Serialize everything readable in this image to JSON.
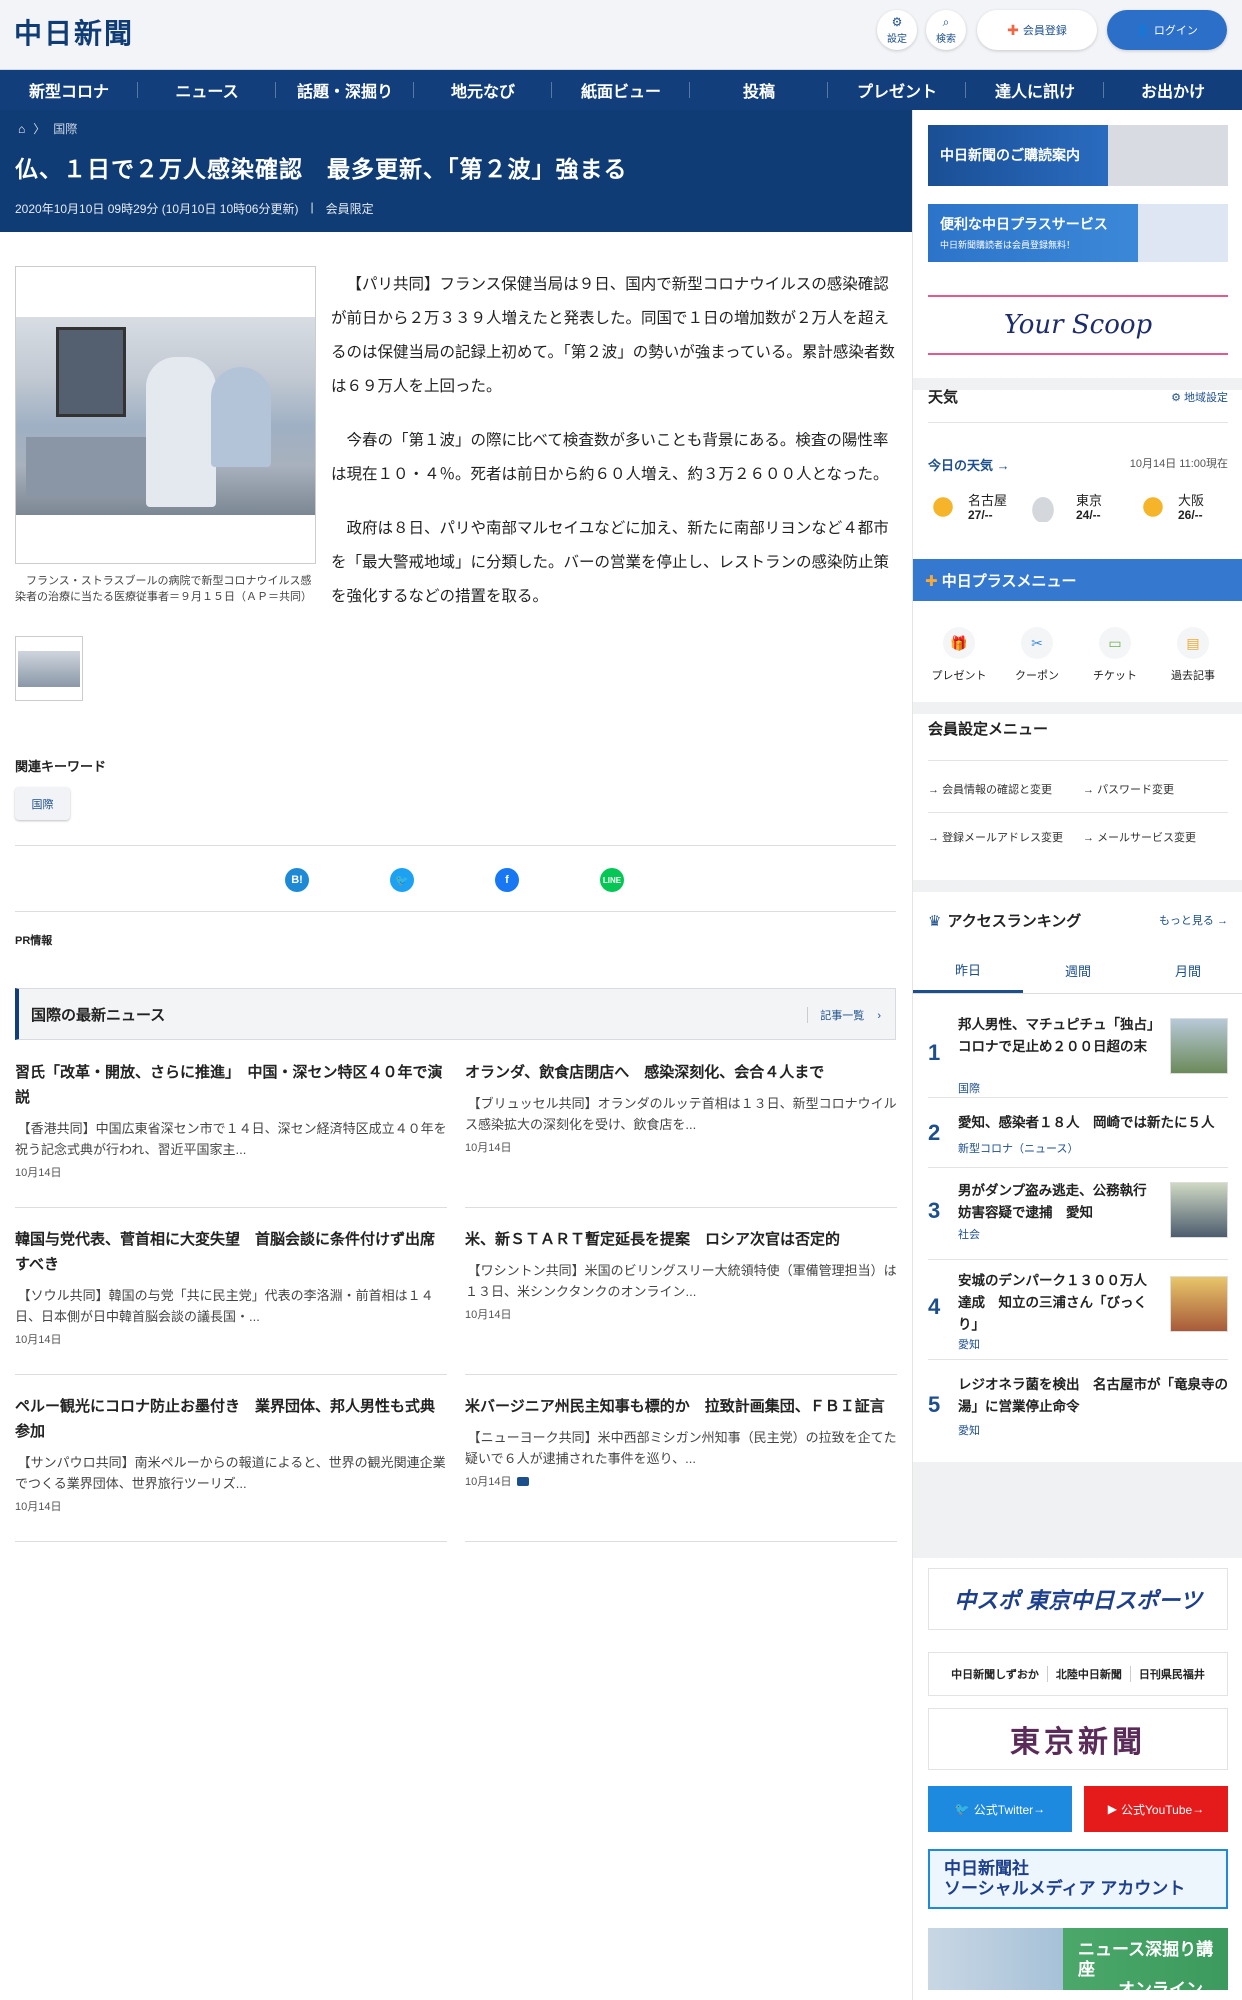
{
  "header": {
    "logo": "中日新聞",
    "settings_label": "設定",
    "search_label": "検索",
    "register_label": "会員登録",
    "login_label": "ログイン"
  },
  "nav": [
    "新型コロナ",
    "ニュース",
    "話題・深掘り",
    "地元なび",
    "紙面ビュー",
    "投稿",
    "プレゼント",
    "達人に訊け",
    "お出かけ"
  ],
  "article": {
    "breadcrumb": "国際",
    "title": "仏、１日で２万人感染確認　最多更新、「第２波」強まる",
    "date": "2020年10月10日 09時29分 (10月10日 10時06分更新)",
    "badge": "会員限定",
    "caption": "フランス・ストラスブールの病院で新型コロナウイルス感染者の治療に当たる医療従事者＝９月１５日（ＡＰ＝共同）",
    "paragraphs": [
      "【パリ共同】フランス保健当局は９日、国内で新型コロナウイルスの感染確認が前日から２万３３９人増えたと発表した。同国で１日の増加数が２万人を超えるのは保健当局の記録上初めて。「第２波」の勢いが強まっている。累計感染者数は６９万人を上回った。",
      "今春の「第１波」の際に比べて検査数が多いことも背景にある。検査の陽性率は現在１０・４％。死者は前日から約６０人増え、約３万２６００人となった。",
      "政府は８日、パリや南部マルセイユなどに加え、新たに南部リヨンなど４都市を「最大警戒地域」に分類した。バーの営業を停止し、レストランの感染防止策を強化するなどの措置を取る。"
    ],
    "keywords_label": "関連キーワード",
    "keyword": "国際",
    "pr_label": "PR情報"
  },
  "share": {
    "hatena": "B!",
    "line": "LINE"
  },
  "news_section": {
    "title": "国際の最新ニュース",
    "more": "記事一覧",
    "items": [
      {
        "title": "習氏「改革・開放、さらに推進」　中国・深セン特区４０年で演説",
        "snippet": "【香港共同】中国広東省深セン市で１４日、深セン経済特区成立４０年を祝う記念式典が行われ、習近平国家主...",
        "date": "10月14日"
      },
      {
        "title": "オランダ、飲食店閉店へ　感染深刻化、会合４人まで",
        "snippet": "【ブリュッセル共同】オランダのルッテ首相は１３日、新型コロナウイルス感染拡大の深刻化を受け、飲食店を...",
        "date": "10月14日"
      },
      {
        "title": "韓国与党代表、菅首相に大変失望　首脳会談に条件付けず出席すべき",
        "snippet": "【ソウル共同】韓国の与党「共に民主党」代表の李洛淵・前首相は１４日、日本側が日中韓首脳会談の議長国・...",
        "date": "10月14日"
      },
      {
        "title": "米、新ＳＴＡＲＴ暫定延長を提案　ロシア次官は否定的",
        "snippet": "【ワシントン共同】米国のビリングスリー大統領特使（軍備管理担当）は１３日、米シンクタンクのオンライン...",
        "date": "10月14日"
      },
      {
        "title": "ペルー観光にコロナ防止お墨付き　業界団体、邦人男性も式典参加",
        "snippet": "【サンパウロ共同】南米ペルーからの報道によると、世界の観光関連企業でつくる業界団体、世界旅行ツーリズ...",
        "date": "10月14日"
      },
      {
        "title": "米バージニア州民主知事も標的か　拉致計画集団、ＦＢＩ証言",
        "snippet": "【ニューヨーク共同】米中西部ミシガン州知事（民主党）の拉致を企てた疑いで６人が逮捕された事件を巡り、...",
        "date": "10月14日"
      }
    ]
  },
  "sidebar": {
    "banner_subscribe": "中日新聞のご購読案内",
    "banner_plus": "便利な中日プラスサービス",
    "banner_plus_sub": "中日新聞購読者は会員登録無料！",
    "banner_scoop": "Your Scoop",
    "weather_title": "天気",
    "region_setting": "地域設定",
    "weather_today": "今日の天気",
    "weather_time": "10月14日 11:00現在",
    "weather": [
      {
        "city": "名古屋",
        "temp": "27/--",
        "icon": "sun"
      },
      {
        "city": "東京",
        "temp": "24/--",
        "icon": "cloud"
      },
      {
        "city": "大阪",
        "temp": "26/--",
        "icon": "sun"
      }
    ],
    "plus_menu_title": "中日プラスメニュー",
    "plus_menu": [
      "プレゼント",
      "クーポン",
      "チケット",
      "過去記事"
    ],
    "member_title": "会員設定メニュー",
    "member_links": [
      "会員情報の確認と変更",
      "パスワード変更",
      "登録メールアドレス変更",
      "メールサービス変更"
    ],
    "ranking_title": "アクセスランキング",
    "ranking_more": "もっと見る",
    "tabs": [
      "昨日",
      "週間",
      "月間"
    ],
    "ranking": [
      {
        "num": "1",
        "title": "邦人男性、マチュピチュ「独占」　コロナで足止め２００日超の末",
        "cat": "国際"
      },
      {
        "num": "2",
        "title": "愛知、感染者１８人　岡崎では新たに５人",
        "cat": "新型コロナ（ニュース）"
      },
      {
        "num": "3",
        "title": "男がダンプ盗み逃走、公務執行妨害容疑で逮捕　愛知",
        "cat": "社会"
      },
      {
        "num": "4",
        "title": "安城のデンパーク１３００万人達成　知立の三浦さん「びっくり」",
        "cat": "愛知"
      },
      {
        "num": "5",
        "title": "レジオネラ菌を検出　名古屋市が「竜泉寺の湯」に営業停止命令",
        "cat": "愛知"
      }
    ],
    "chuspo": "中スポ 東京中日スポーツ",
    "regional": [
      "中日新聞しずおか",
      "北陸中日新聞",
      "日刊県民福井"
    ],
    "tokyo": "東京新聞",
    "twitter_btn": "公式Twitter",
    "youtube_btn": "公式YouTube",
    "sns_line1": "中日新聞社",
    "sns_line2": "ソーシャルメディア アカウント",
    "fukabori_line1": "ニュース深掘り講座",
    "fukabori_line2": "オンライン"
  }
}
